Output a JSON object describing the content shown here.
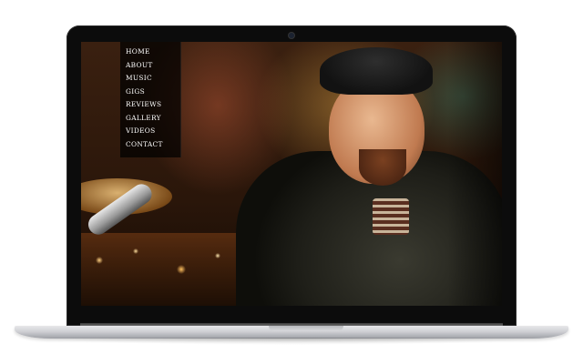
{
  "nav": {
    "items": [
      {
        "label": "HOME"
      },
      {
        "label": "ABOUT"
      },
      {
        "label": "MUSIC"
      },
      {
        "label": "GIGS"
      },
      {
        "label": "REVIEWS"
      },
      {
        "label": "GALLERY"
      },
      {
        "label": "VIDEOS"
      },
      {
        "label": "CONTACT"
      }
    ]
  }
}
